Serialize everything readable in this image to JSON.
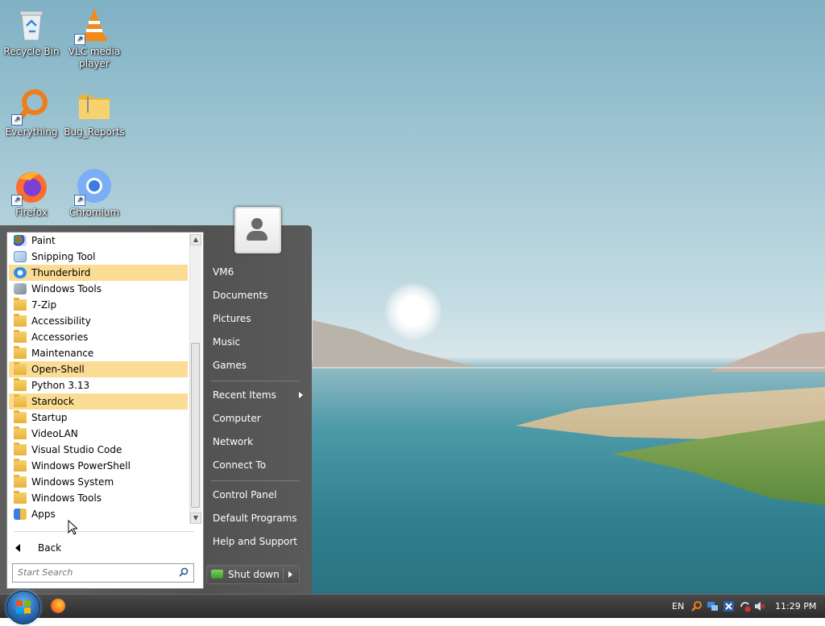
{
  "desktop": {
    "icons": [
      {
        "label": "Recycle Bin",
        "icon": "recycle-bin-icon"
      },
      {
        "label": "VLC media player",
        "icon": "vlc-icon"
      },
      {
        "label": "Everything",
        "icon": "everything-search-icon"
      },
      {
        "label": "Bug_Reports",
        "icon": "folder-icon"
      },
      {
        "label": "Firefox",
        "icon": "firefox-icon"
      },
      {
        "label": "Chromium",
        "icon": "chromium-icon"
      }
    ]
  },
  "start_menu": {
    "programs": [
      {
        "label": "Paint",
        "icon": "paint-icon",
        "highlighted": false
      },
      {
        "label": "Snipping Tool",
        "icon": "snipping-tool-icon",
        "highlighted": false
      },
      {
        "label": "Thunderbird",
        "icon": "thunderbird-icon",
        "highlighted": true
      },
      {
        "label": "Windows Tools",
        "icon": "windows-tools-icon",
        "highlighted": false
      },
      {
        "label": "7-Zip",
        "icon": "folder-icon",
        "highlighted": false
      },
      {
        "label": "Accessibility",
        "icon": "folder-icon",
        "highlighted": false
      },
      {
        "label": "Accessories",
        "icon": "folder-icon",
        "highlighted": false
      },
      {
        "label": "Maintenance",
        "icon": "folder-icon",
        "highlighted": false
      },
      {
        "label": "Open-Shell",
        "icon": "folder-icon",
        "highlighted": true
      },
      {
        "label": "Python 3.13",
        "icon": "folder-icon",
        "highlighted": false
      },
      {
        "label": "Stardock",
        "icon": "folder-icon",
        "highlighted": true
      },
      {
        "label": "Startup",
        "icon": "folder-icon",
        "highlighted": false
      },
      {
        "label": "VideoLAN",
        "icon": "folder-icon",
        "highlighted": false
      },
      {
        "label": "Visual Studio Code",
        "icon": "folder-icon",
        "highlighted": false
      },
      {
        "label": "Windows PowerShell",
        "icon": "folder-icon",
        "highlighted": false
      },
      {
        "label": "Windows System",
        "icon": "folder-icon",
        "highlighted": false
      },
      {
        "label": "Windows Tools",
        "icon": "folder-icon",
        "highlighted": false
      },
      {
        "label": "Apps",
        "icon": "apps-icon",
        "highlighted": false
      }
    ],
    "back_label": "Back",
    "search_placeholder": "Start Search",
    "right_items": [
      {
        "label": "VM6"
      },
      {
        "label": "Documents"
      },
      {
        "label": "Pictures"
      },
      {
        "label": "Music"
      },
      {
        "label": "Games"
      },
      {
        "label": "Recent Items",
        "has_submenu": true
      },
      {
        "label": "Computer"
      },
      {
        "label": "Network"
      },
      {
        "label": "Connect To"
      },
      {
        "label": "Control Panel"
      },
      {
        "label": "Default Programs"
      },
      {
        "label": "Help and Support"
      }
    ],
    "shutdown_label": "Shut down"
  },
  "taskbar": {
    "language": "EN",
    "clock": "11:29 PM"
  },
  "colors": {
    "highlight": "#fbdc94",
    "menu_dark": "#555555"
  }
}
